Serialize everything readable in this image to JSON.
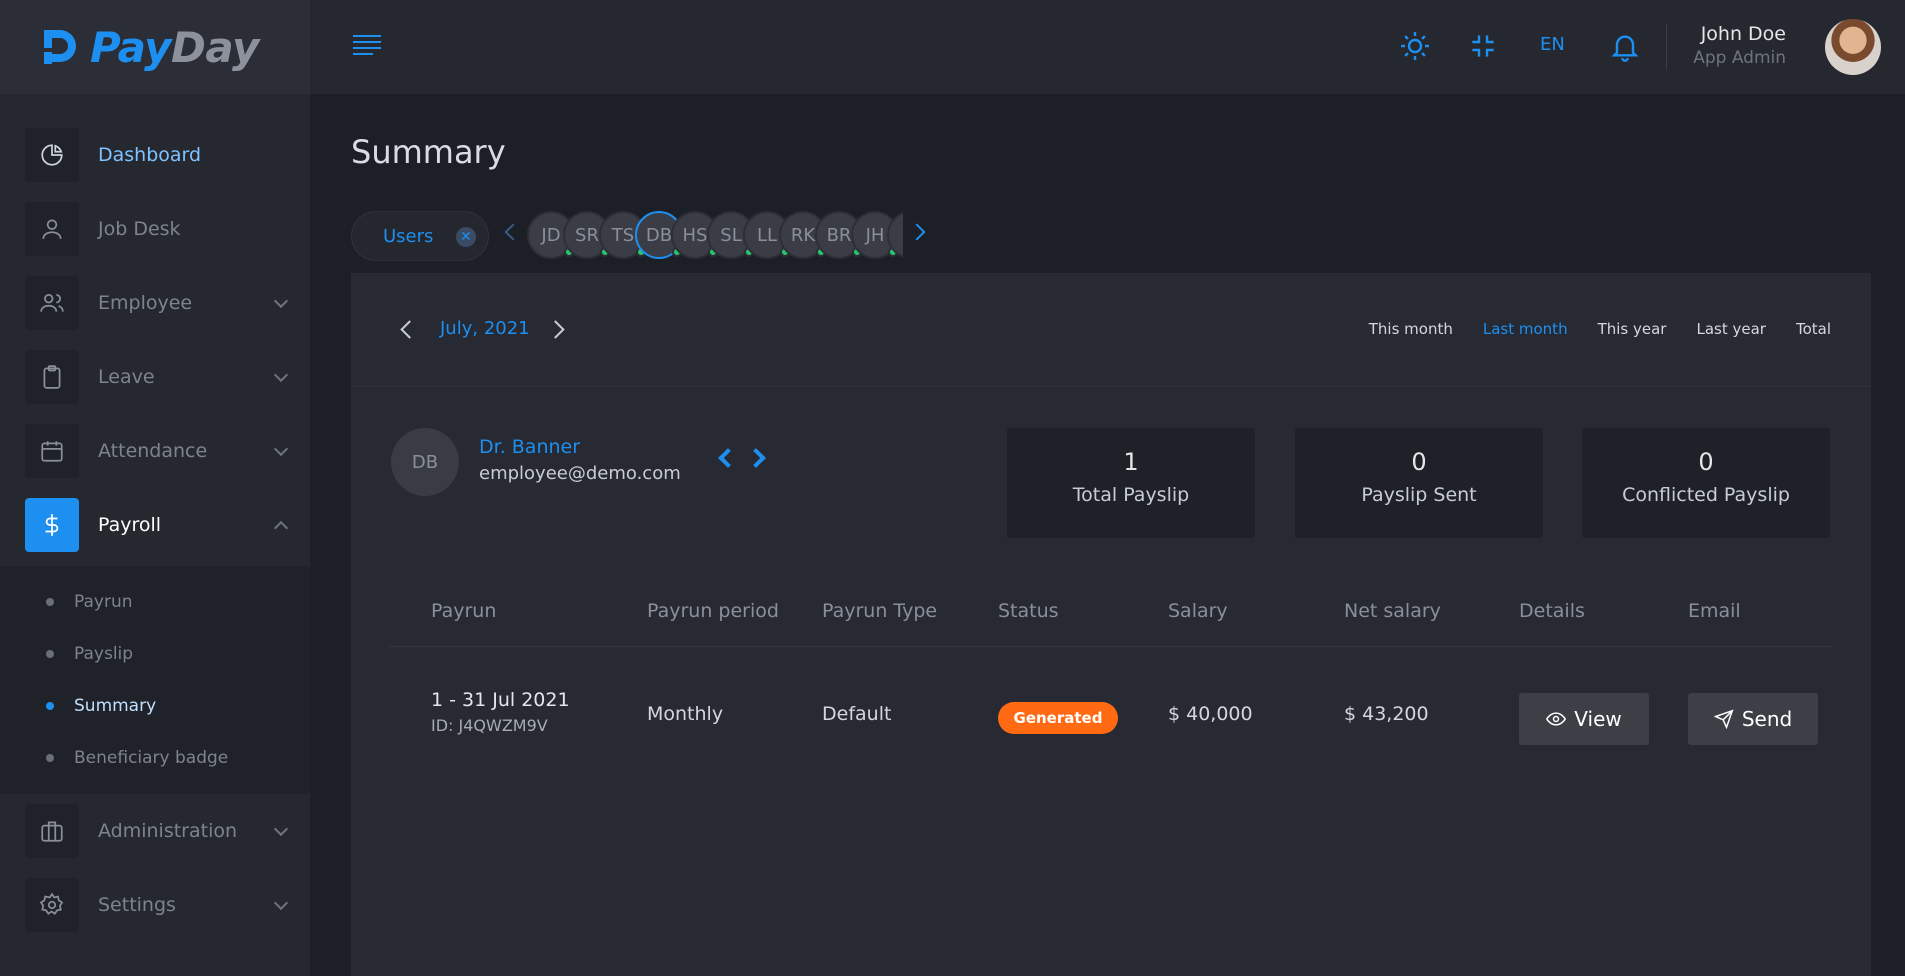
{
  "brand": {
    "pay": "Pay",
    "day": "Day"
  },
  "sidebar": {
    "items": [
      {
        "label": "Dashboard",
        "icon": "pie-chart-icon"
      },
      {
        "label": "Job Desk",
        "icon": "user-icon"
      },
      {
        "label": "Employee",
        "icon": "users-icon"
      },
      {
        "label": "Leave",
        "icon": "clipboard-icon"
      },
      {
        "label": "Attendance",
        "icon": "calendar-icon"
      },
      {
        "label": "Payroll",
        "icon": "dollar-icon"
      },
      {
        "label": "Administration",
        "icon": "briefcase-icon"
      },
      {
        "label": "Settings",
        "icon": "gear-icon"
      }
    ],
    "payroll_sub": [
      {
        "label": "Payrun"
      },
      {
        "label": "Payslip"
      },
      {
        "label": "Summary"
      },
      {
        "label": "Beneficiary badge"
      }
    ]
  },
  "topbar": {
    "language": "EN",
    "user_name": "John Doe",
    "user_role": "App Admin"
  },
  "page": {
    "title": "Summary",
    "users_chip": "Users",
    "avatars": [
      "JD",
      "SR",
      "TS",
      "DB",
      "HS",
      "SL",
      "LL",
      "RK",
      "BR",
      "JH"
    ]
  },
  "card": {
    "date": "July, 2021",
    "filters": [
      "This month",
      "Last month",
      "This year",
      "Last year",
      "Total"
    ],
    "employee": {
      "initials": "DB",
      "name": "Dr. Banner",
      "email": "employee@demo.com"
    },
    "stats": [
      {
        "value": "1",
        "label": "Total Payslip"
      },
      {
        "value": "0",
        "label": "Payslip Sent"
      },
      {
        "value": "0",
        "label": "Conflicted Payslip"
      }
    ],
    "table": {
      "headers": [
        "Payrun",
        "Payrun period",
        "Payrun Type",
        "Status",
        "Salary",
        "Net salary",
        "Details",
        "Email"
      ],
      "rows": [
        {
          "payrun": "1 - 31 Jul 2021",
          "id": "ID: J4QWZM9V",
          "period": "Monthly",
          "type": "Default",
          "status": "Generated",
          "salary": "$ 40,000",
          "net_salary": "$ 43,200",
          "details_btn": "View",
          "email_btn": "Send"
        }
      ]
    }
  },
  "colors": {
    "accent": "#1d8ff0",
    "status_generated": "#ff6a13",
    "online": "#28c76f"
  }
}
